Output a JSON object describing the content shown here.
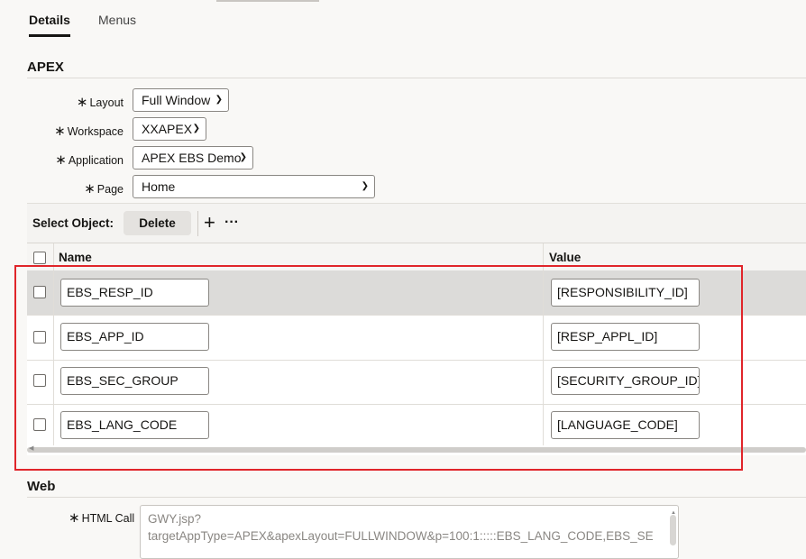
{
  "tabs": [
    {
      "label": "Details"
    },
    {
      "label": "Menus"
    }
  ],
  "apex_section": {
    "title": "APEX",
    "fields": [
      {
        "label": "Layout",
        "value": "Full Window"
      },
      {
        "label": "Workspace",
        "value": "XXAPEX"
      },
      {
        "label": "Application",
        "value": "APEX EBS Demo"
      },
      {
        "label": "Page",
        "value": "Home"
      }
    ]
  },
  "toolbar": {
    "label": "Select Object:",
    "delete_label": "Delete",
    "add_icon": "+",
    "more_icon": "···"
  },
  "grid": {
    "columns": [
      "Name",
      "Value"
    ],
    "rows": [
      {
        "name": "EBS_RESP_ID",
        "value": "[RESPONSIBILITY_ID]",
        "selected": true
      },
      {
        "name": "EBS_APP_ID",
        "value": "[RESP_APPL_ID]",
        "selected": false
      },
      {
        "name": "EBS_SEC_GROUP",
        "value": "[SECURITY_GROUP_ID]",
        "selected": false
      },
      {
        "name": "EBS_LANG_CODE",
        "value": "[LANGUAGE_CODE]",
        "selected": false
      }
    ]
  },
  "web_section": {
    "title": "Web",
    "html_call_label": "HTML Call",
    "html_call_lines": [
      "GWY.jsp?",
      "targetAppType=APEX&apexLayout=FULLWINDOW&p=100:1:::::EBS_LANG_CODE,EBS_SE"
    ]
  },
  "required_marker": "∗",
  "colors": {
    "highlight_border": "#e0252a",
    "selected_row": "#dcdbd9"
  }
}
